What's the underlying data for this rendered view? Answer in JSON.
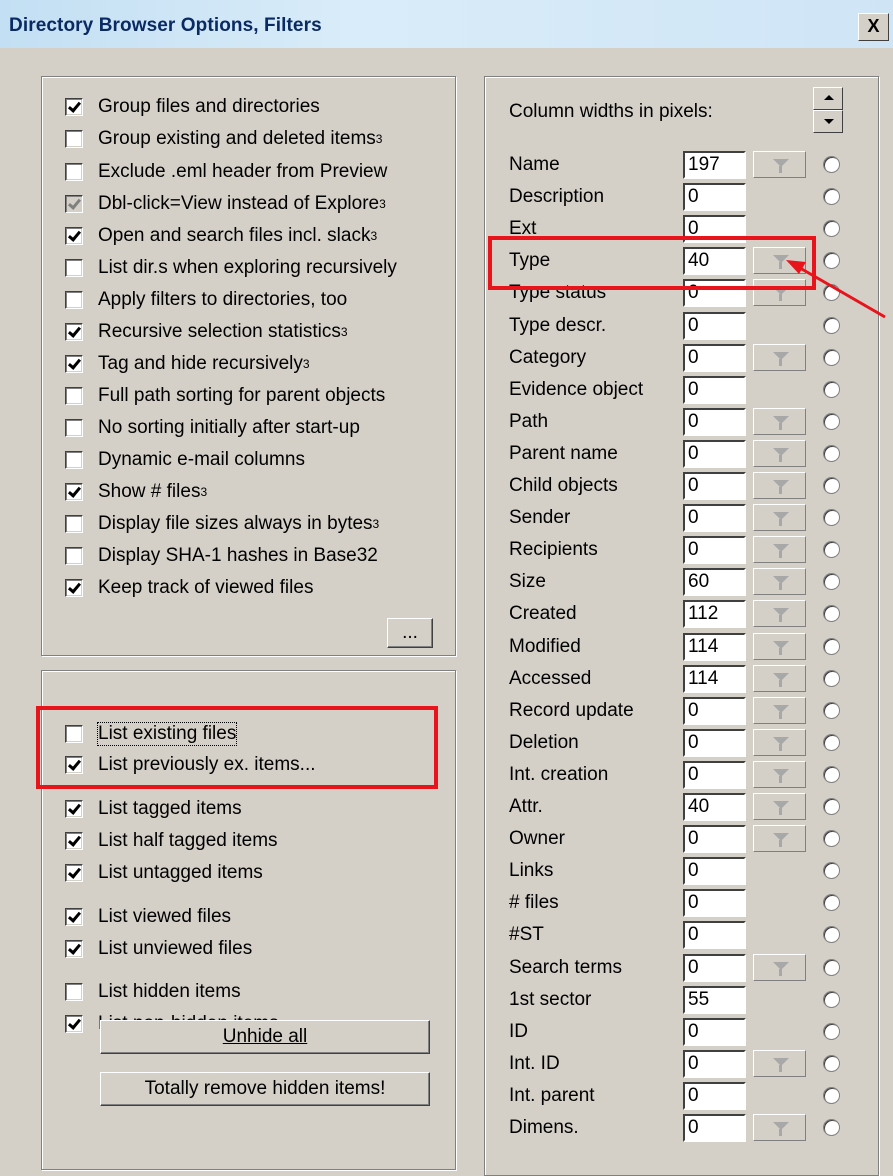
{
  "window": {
    "title": "Directory Browser Options, Filters",
    "close_glyph": "X"
  },
  "options": [
    {
      "label": "Group files and directories",
      "checked": true,
      "grey": false,
      "sup": ""
    },
    {
      "label": "Group existing and deleted items",
      "checked": false,
      "grey": false,
      "sup": "3"
    },
    {
      "label": "Exclude .eml header from Preview",
      "checked": false,
      "grey": false,
      "sup": ""
    },
    {
      "label": "Dbl-click=View instead of Explore",
      "checked": true,
      "grey": true,
      "sup": "3"
    },
    {
      "label": "Open and search files incl. slack",
      "checked": true,
      "grey": false,
      "sup": "3"
    },
    {
      "label": "List dir.s when exploring recursively",
      "checked": false,
      "grey": false,
      "sup": ""
    },
    {
      "label": "Apply filters to directories, too",
      "checked": false,
      "grey": false,
      "sup": ""
    },
    {
      "label": "Recursive selection statistics",
      "checked": true,
      "grey": false,
      "sup": "3"
    },
    {
      "label": "Tag and hide recursively",
      "checked": true,
      "grey": false,
      "sup": "3"
    },
    {
      "label": "Full path sorting for parent objects",
      "checked": false,
      "grey": false,
      "sup": ""
    },
    {
      "label": "No sorting initially after start-up",
      "checked": false,
      "grey": false,
      "sup": ""
    },
    {
      "label": "Dynamic e-mail columns",
      "checked": false,
      "grey": false,
      "sup": ""
    },
    {
      "label": "Show # files",
      "checked": true,
      "grey": false,
      "sup": "3"
    },
    {
      "label": "Display file sizes always in bytes",
      "checked": false,
      "grey": false,
      "sup": "3"
    },
    {
      "label": "Display SHA-1 hashes in Base32",
      "checked": false,
      "grey": false,
      "sup": ""
    },
    {
      "label": "Keep track of viewed files",
      "checked": true,
      "grey": false,
      "sup": ""
    }
  ],
  "ellipsis_label": "...",
  "filters": [
    {
      "label": "List existing files",
      "checked": false
    },
    {
      "label": "List previously ex. items...",
      "checked": true
    },
    {
      "label": "List tagged items",
      "checked": true
    },
    {
      "label": "List half tagged items",
      "checked": true
    },
    {
      "label": "List untagged items",
      "checked": true
    },
    {
      "label": "List viewed files",
      "checked": true
    },
    {
      "label": "List unviewed files",
      "checked": true
    },
    {
      "label": "List hidden items",
      "checked": false
    },
    {
      "label": "List non-hidden items",
      "checked": true
    }
  ],
  "buttons": {
    "unhide_all": "Unhide all",
    "remove_hidden": "Totally remove hidden items!"
  },
  "columns_title": "Column widths in pixels:",
  "columns": [
    {
      "name": "Name",
      "width": "197",
      "filter": true
    },
    {
      "name": "Description",
      "width": "0",
      "filter": false
    },
    {
      "name": "Ext",
      "width": "0",
      "filter": false
    },
    {
      "name": "Type",
      "width": "40",
      "filter": true
    },
    {
      "name": "Type status",
      "width": "0",
      "filter": true
    },
    {
      "name": "Type descr.",
      "width": "0",
      "filter": false
    },
    {
      "name": "Category",
      "width": "0",
      "filter": true
    },
    {
      "name": "Evidence object",
      "width": "0",
      "filter": false
    },
    {
      "name": "Path",
      "width": "0",
      "filter": true
    },
    {
      "name": "Parent name",
      "width": "0",
      "filter": true
    },
    {
      "name": "Child objects",
      "width": "0",
      "filter": true
    },
    {
      "name": "Sender",
      "width": "0",
      "filter": true
    },
    {
      "name": "Recipients",
      "width": "0",
      "filter": true
    },
    {
      "name": "Size",
      "width": "60",
      "filter": true
    },
    {
      "name": "Created",
      "width": "112",
      "filter": true
    },
    {
      "name": "Modified",
      "width": "114",
      "filter": true
    },
    {
      "name": "Accessed",
      "width": "114",
      "filter": true
    },
    {
      "name": "Record update",
      "width": "0",
      "filter": true
    },
    {
      "name": "Deletion",
      "width": "0",
      "filter": true
    },
    {
      "name": "Int. creation",
      "width": "0",
      "filter": true
    },
    {
      "name": "Attr.",
      "width": "40",
      "filter": true
    },
    {
      "name": "Owner",
      "width": "0",
      "filter": true
    },
    {
      "name": "Links",
      "width": "0",
      "filter": false
    },
    {
      "name": "# files",
      "width": "0",
      "filter": false
    },
    {
      "name": "#ST",
      "width": "0",
      "filter": false
    },
    {
      "name": "Search terms",
      "width": "0",
      "filter": true
    },
    {
      "name": "1st sector",
      "width": "55",
      "filter": false
    },
    {
      "name": "ID",
      "width": "0",
      "filter": false
    },
    {
      "name": "Int. ID",
      "width": "0",
      "filter": true
    },
    {
      "name": "Int. parent",
      "width": "0",
      "filter": false
    },
    {
      "name": "Dimens.",
      "width": "0",
      "filter": true
    }
  ],
  "colors": {
    "highlight": "#e8141b",
    "dialog": "#d4d0c8",
    "title_text": "#0a2a63"
  },
  "icons": {
    "filter": "funnel-icon",
    "spin_up": "arrow-up-icon",
    "spin_down": "arrow-down-icon"
  }
}
